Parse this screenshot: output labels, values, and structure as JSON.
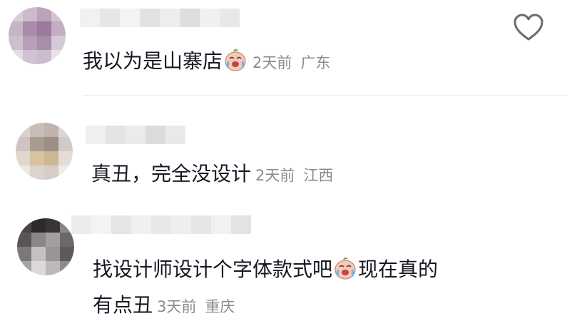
{
  "comments": [
    {
      "text": "我以为是山寨店",
      "has_emoji": true,
      "time": "2天前",
      "location": "广东"
    },
    {
      "text": "真丑，完全没设计",
      "time": "2天前",
      "location": "江西"
    },
    {
      "text_line1_before_emoji": "找设计师设计个字体款式吧",
      "text_line1_after_emoji": "现在真的",
      "text_line2": "有点丑",
      "time": "3天前",
      "location": "重庆"
    }
  ],
  "icons": {
    "like": "heart-outline-icon",
    "emoji": "crying-laughing-emoji-icon"
  },
  "colors": {
    "text": "#161823",
    "meta": "#8a8b91",
    "divider": "#ececec"
  }
}
